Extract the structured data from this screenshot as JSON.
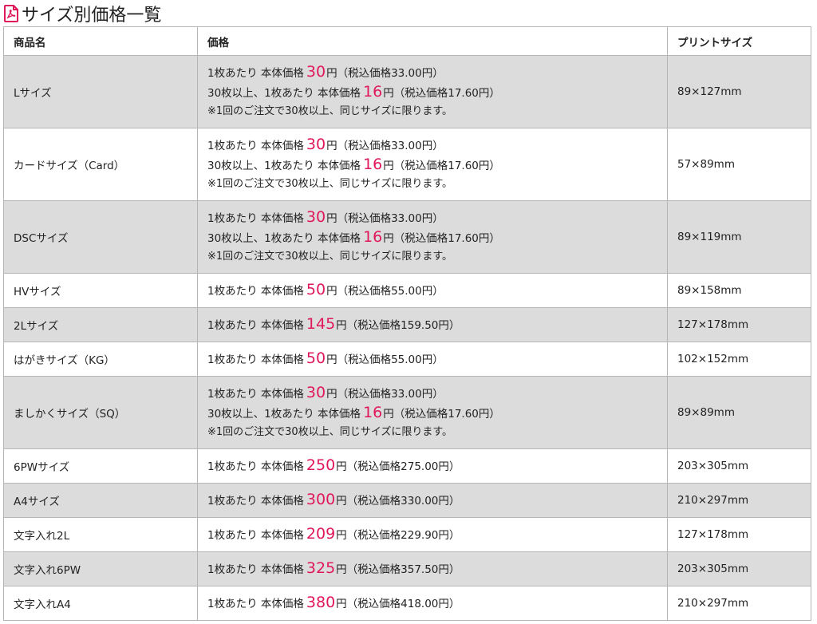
{
  "page": {
    "title": "サイズ別価格一覧",
    "icon": "pdf-document-icon",
    "accent_color": "#e0185a"
  },
  "table": {
    "headers": [
      "商品名",
      "価格",
      "プリントサイズ"
    ],
    "rows": [
      {
        "name": "Lサイズ",
        "lines": [
          {
            "prefix": "1枚あたり 本体価格",
            "amount": "30",
            "suffix": "円（税込価格33.00円）"
          },
          {
            "prefix": "30枚以上、1枚あたり 本体価格",
            "amount": "16",
            "suffix": "円（税込価格17.60円）"
          }
        ],
        "note": "※1回のご注文で30枚以上、同じサイズに限ります。",
        "size": "89×127mm"
      },
      {
        "name": "カードサイズ（Card）",
        "lines": [
          {
            "prefix": "1枚あたり 本体価格",
            "amount": "30",
            "suffix": "円（税込価格33.00円）"
          },
          {
            "prefix": "30枚以上、1枚あたり 本体価格",
            "amount": "16",
            "suffix": "円（税込価格17.60円）"
          }
        ],
        "note": "※1回のご注文で30枚以上、同じサイズに限ります。",
        "size": "57×89mm"
      },
      {
        "name": "DSCサイズ",
        "lines": [
          {
            "prefix": "1枚あたり 本体価格",
            "amount": "30",
            "suffix": "円（税込価格33.00円）"
          },
          {
            "prefix": "30枚以上、1枚あたり 本体価格",
            "amount": "16",
            "suffix": "円（税込価格17.60円）"
          }
        ],
        "note": "※1回のご注文で30枚以上、同じサイズに限ります。",
        "size": "89×119mm"
      },
      {
        "name": "HVサイズ",
        "lines": [
          {
            "prefix": "1枚あたり 本体価格",
            "amount": "50",
            "suffix": "円（税込価格55.00円）"
          }
        ],
        "note": "",
        "size": "89×158mm"
      },
      {
        "name": "2Lサイズ",
        "lines": [
          {
            "prefix": "1枚あたり 本体価格",
            "amount": "145",
            "suffix": "円（税込価格159.50円）"
          }
        ],
        "note": "",
        "size": "127×178mm"
      },
      {
        "name": "はがきサイズ（KG）",
        "lines": [
          {
            "prefix": "1枚あたり 本体価格",
            "amount": "50",
            "suffix": "円（税込価格55.00円）"
          }
        ],
        "note": "",
        "size": "102×152mm"
      },
      {
        "name": "ましかくサイズ（SQ）",
        "lines": [
          {
            "prefix": "1枚あたり 本体価格",
            "amount": "30",
            "suffix": "円（税込価格33.00円）"
          },
          {
            "prefix": "30枚以上、1枚あたり 本体価格",
            "amount": "16",
            "suffix": "円（税込価格17.60円）"
          }
        ],
        "note": "※1回のご注文で30枚以上、同じサイズに限ります。",
        "size": "89×89mm"
      },
      {
        "name": "6PWサイズ",
        "lines": [
          {
            "prefix": "1枚あたり 本体価格",
            "amount": "250",
            "suffix": "円（税込価格275.00円）"
          }
        ],
        "note": "",
        "size": "203×305mm"
      },
      {
        "name": "A4サイズ",
        "lines": [
          {
            "prefix": "1枚あたり 本体価格",
            "amount": "300",
            "suffix": "円（税込価格330.00円）"
          }
        ],
        "note": "",
        "size": "210×297mm"
      },
      {
        "name": "文字入れ2L",
        "lines": [
          {
            "prefix": "1枚あたり 本体価格",
            "amount": "209",
            "suffix": "円（税込価格229.90円）"
          }
        ],
        "note": "",
        "size": "127×178mm"
      },
      {
        "name": "文字入れ6PW",
        "lines": [
          {
            "prefix": "1枚あたり 本体価格",
            "amount": "325",
            "suffix": "円（税込価格357.50円）"
          }
        ],
        "note": "",
        "size": "203×305mm"
      },
      {
        "name": "文字入れA4",
        "lines": [
          {
            "prefix": "1枚あたり 本体価格",
            "amount": "380",
            "suffix": "円（税込価格418.00円）"
          }
        ],
        "note": "",
        "size": "210×297mm"
      }
    ]
  }
}
